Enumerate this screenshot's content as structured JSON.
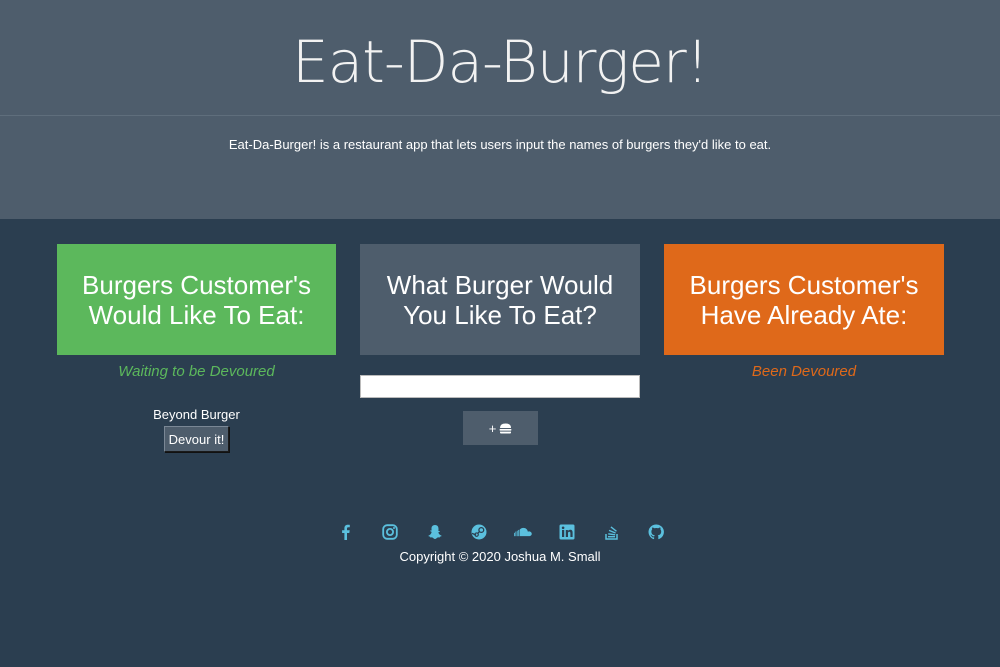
{
  "header": {
    "title": "Eat-Da-Burger!",
    "description": "Eat-Da-Burger! is a restaurant app that lets users input the names of burgers they'd like to eat."
  },
  "columns": {
    "waiting": {
      "heading": "Burgers Customer's Would Like To Eat:",
      "subheading": "Waiting to be Devoured",
      "items": [
        {
          "name": "Beyond Burger",
          "button_label": "Devour it!"
        }
      ]
    },
    "add": {
      "heading": "What Burger Would You Like To Eat?",
      "input_value": "",
      "button_label": "+",
      "button_icon": "hamburger-icon"
    },
    "devoured": {
      "heading": "Burgers Customer's Have Already Ate:",
      "subheading": "Been Devoured",
      "items": []
    }
  },
  "footer": {
    "social_icons": [
      "facebook-icon",
      "instagram-icon",
      "snapchat-icon",
      "steam-icon",
      "soundcloud-icon",
      "linkedin-icon",
      "stack-overflow-icon",
      "github-icon"
    ],
    "copyright": "Copyright © 2020 Joshua M. Small"
  },
  "colors": {
    "background": "#2b3e50",
    "header_bg": "#4e5d6c",
    "waiting_green": "#5cb85c",
    "devoured_orange": "#df691a",
    "social_icon_blue": "#5bc0de"
  }
}
